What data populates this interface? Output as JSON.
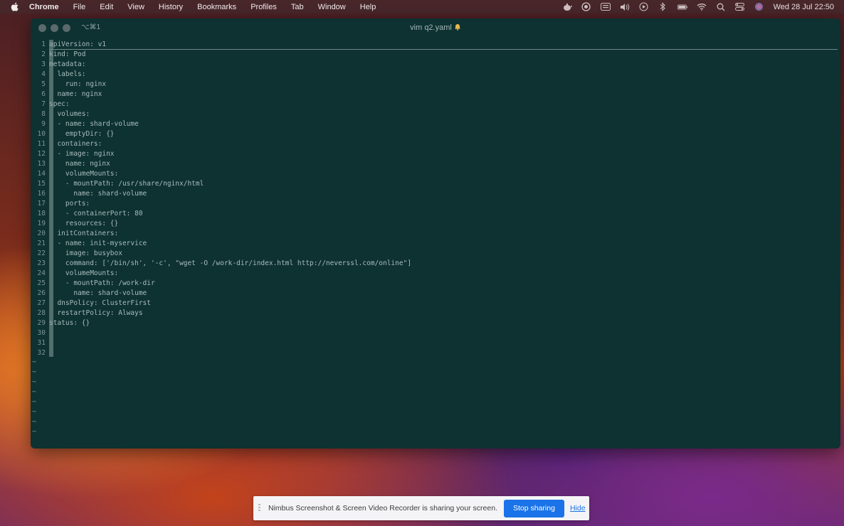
{
  "menubar": {
    "app": "Chrome",
    "items": [
      "File",
      "Edit",
      "View",
      "History",
      "Bookmarks",
      "Profiles",
      "Tab",
      "Window",
      "Help"
    ],
    "clock": "Wed 28 Jul  22:50"
  },
  "window": {
    "shortcut": "⌥⌘1",
    "title": "vim q2.yaml"
  },
  "editor": {
    "lines": [
      {
        "n": "1",
        "text": "apiVersion: v1"
      },
      {
        "n": "2",
        "text": "kind: Pod"
      },
      {
        "n": "3",
        "text": "metadata:"
      },
      {
        "n": "4",
        "text": "  labels:"
      },
      {
        "n": "5",
        "text": "    run: nginx"
      },
      {
        "n": "6",
        "text": "  name: nginx"
      },
      {
        "n": "7",
        "text": "spec:"
      },
      {
        "n": "8",
        "text": "  volumes:"
      },
      {
        "n": "9",
        "text": "  - name: shard-volume"
      },
      {
        "n": "10",
        "text": "    emptyDir: {}"
      },
      {
        "n": "11",
        "text": "  containers:"
      },
      {
        "n": "12",
        "text": "  - image: nginx"
      },
      {
        "n": "13",
        "text": "    name: nginx"
      },
      {
        "n": "14",
        "text": "    volumeMounts:"
      },
      {
        "n": "15",
        "text": "    - mountPath: /usr/share/nginx/html"
      },
      {
        "n": "16",
        "text": "      name: shard-volume"
      },
      {
        "n": "17",
        "text": "    ports:"
      },
      {
        "n": "18",
        "text": "    - containerPort: 80"
      },
      {
        "n": "19",
        "text": "    resources: {}"
      },
      {
        "n": "20",
        "text": "  initContainers:"
      },
      {
        "n": "21",
        "text": "  - name: init-myservice"
      },
      {
        "n": "22",
        "text": "    image: busybox"
      },
      {
        "n": "23",
        "text": "    command: ['/bin/sh', '-c', \"wget -O /work-dir/index.html http://neverssl.com/online\"]"
      },
      {
        "n": "24",
        "text": "    volumeMounts:"
      },
      {
        "n": "25",
        "text": "    - mountPath: /work-dir"
      },
      {
        "n": "26",
        "text": "      name: shard-volume"
      },
      {
        "n": "27",
        "text": "  dnsPolicy: ClusterFirst"
      },
      {
        "n": "28",
        "text": "  restartPolicy: Always"
      },
      {
        "n": "29",
        "text": "status: {}"
      },
      {
        "n": "30",
        "text": ""
      },
      {
        "n": "31",
        "text": ""
      },
      {
        "n": "32",
        "text": ""
      }
    ],
    "tildes": [
      "~",
      "~",
      "~",
      "~",
      "~",
      "~",
      "~",
      "~"
    ]
  },
  "sharebar": {
    "message": "Nimbus Screenshot & Screen Video Recorder is sharing your screen.",
    "stop_label": "Stop sharing",
    "hide_label": "Hide"
  }
}
